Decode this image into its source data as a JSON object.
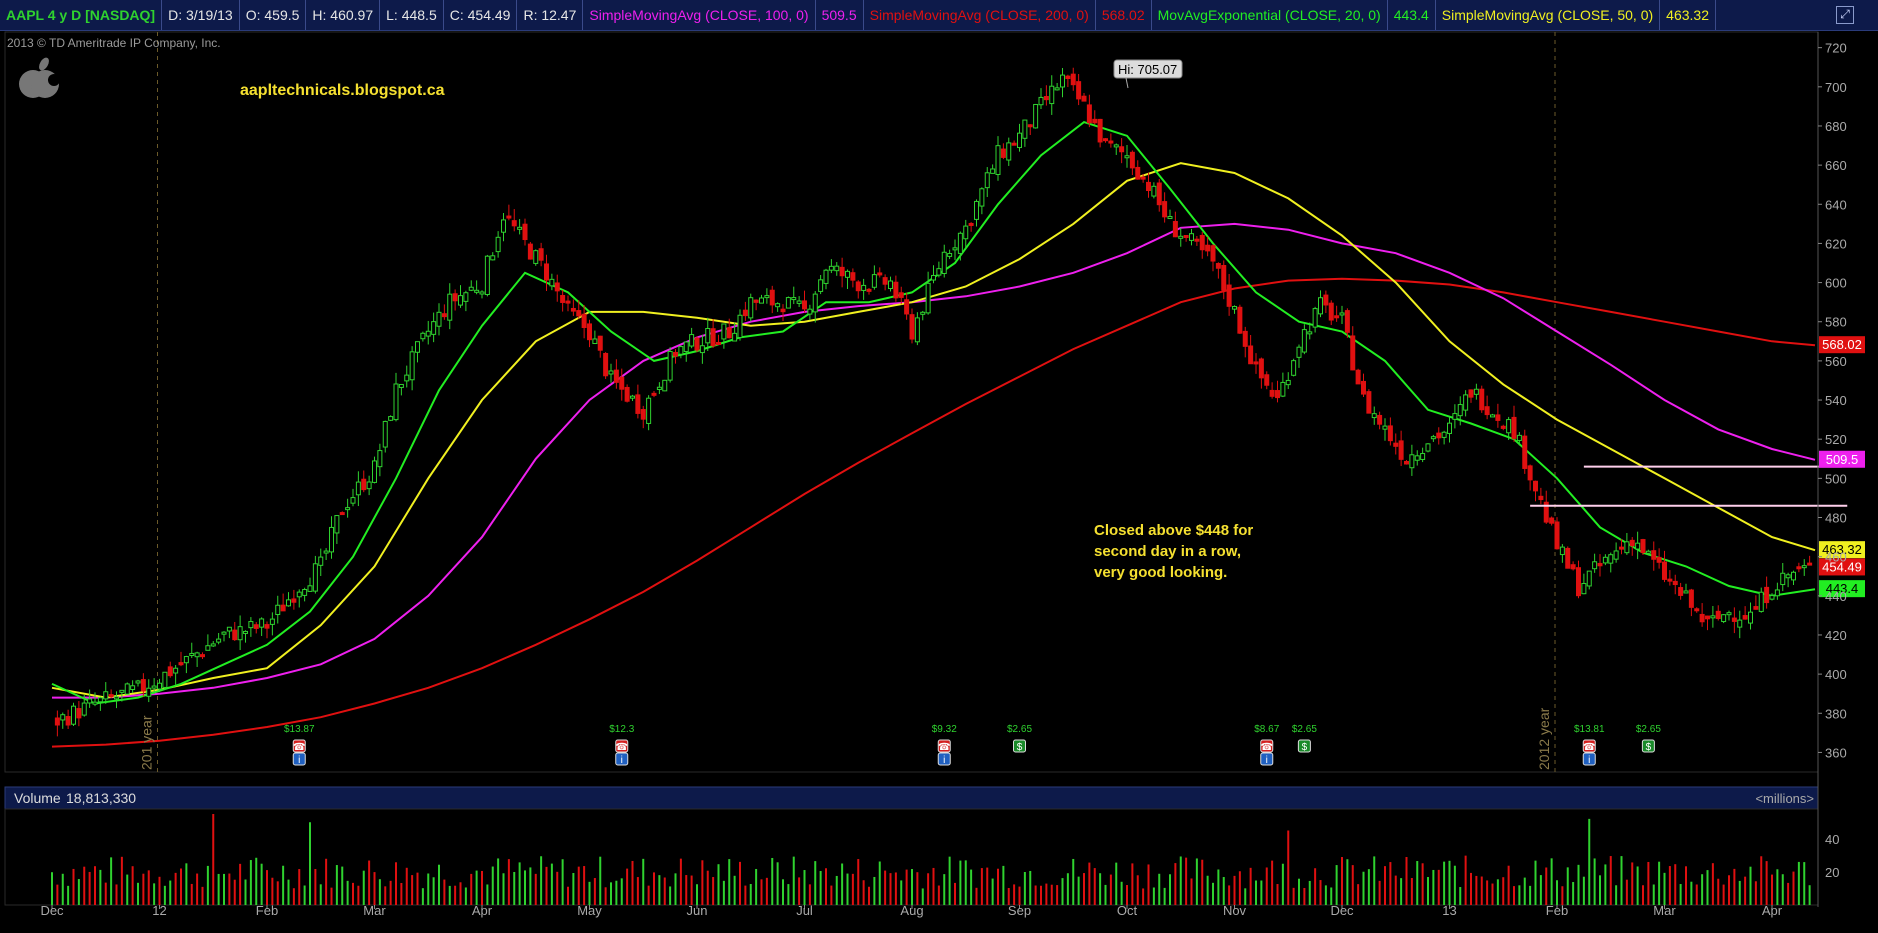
{
  "header": {
    "symbol": "AAPL 4 y D [NASDAQ]",
    "date": "D: 3/19/13",
    "open": "O: 459.5",
    "high": "H: 460.97",
    "low": "L: 448.5",
    "close": "C: 454.49",
    "range": "R: 12.47",
    "sma100_label": "SimpleMovingAvg (CLOSE, 100, 0)",
    "sma100_value": "509.5",
    "sma200_label": "SimpleMovingAvg (CLOSE, 200, 0)",
    "sma200_value": "568.02",
    "ema20_label": "MovAvgExponential (CLOSE, 20, 0)",
    "ema20_value": "443.4",
    "sma50_label": "SimpleMovingAvg (CLOSE, 50, 0)",
    "sma50_value": "463.32",
    "expand_icon": "expand-icon",
    "expand_glyph": "⤢"
  },
  "copyright": "2013 © TD Ameritrade IP Company, Inc.",
  "watermark": "aapltechnicals.blogspot.ca",
  "logo_icon": "apple-logo-icon",
  "annotation": [
    "Closed above $448 for",
    "second day in a row,",
    "very good looking."
  ],
  "high_marker": "Hi: 705.07",
  "year_markers": [
    "201 year",
    "2012 year"
  ],
  "volume_panel": {
    "label": "Volume",
    "value": "18,813,330",
    "units": "<millions>"
  },
  "colors": {
    "up": "#2fd22f",
    "down": "#e01010",
    "ema20": "#22ee22",
    "sma50": "#f0f020",
    "sma100": "#ee20ee",
    "sma200": "#e01010",
    "resistance": "#ffd0ec",
    "header_bg": "#0d1a4a",
    "symbol": "#2fd22f",
    "annotation": "#f5e030"
  },
  "events": [
    {
      "label": "$13.87",
      "month_index": 2.3,
      "icons": [
        "earnings-icon",
        "info-icon"
      ]
    },
    {
      "label": "$12.3",
      "month_index": 5.3,
      "icons": [
        "earnings-icon",
        "info-icon"
      ]
    },
    {
      "label": "$9.32",
      "month_index": 8.3,
      "icons": [
        "earnings-icon",
        "info-icon"
      ]
    },
    {
      "label": "$2.65",
      "month_index": 9.0,
      "icons": [
        "dividend-icon"
      ]
    },
    {
      "label": "$8.67",
      "month_index": 11.3,
      "icons": [
        "earnings-icon",
        "info-icon"
      ]
    },
    {
      "label": "$2.65",
      "month_index": 11.65,
      "icons": [
        "dividend-icon"
      ]
    },
    {
      "label": "$13.81",
      "month_index": 14.3,
      "icons": [
        "earnings-icon",
        "info-icon"
      ]
    },
    {
      "label": "$2.65",
      "month_index": 14.85,
      "icons": [
        "dividend-icon"
      ]
    }
  ],
  "chart_data": {
    "type": "line",
    "title": "AAPL 4 y D [NASDAQ]",
    "x_labels": [
      "Dec",
      "12",
      "Feb",
      "Mar",
      "Apr",
      "May",
      "Jun",
      "Jul",
      "Aug",
      "Sep",
      "Oct",
      "Nov",
      "Dec",
      "13",
      "Feb",
      "Mar",
      "Apr"
    ],
    "y_ticks": [
      360,
      380,
      400,
      420,
      440,
      460,
      480,
      500,
      520,
      540,
      560,
      580,
      600,
      620,
      640,
      660,
      680,
      700,
      720
    ],
    "ylim": [
      350,
      728
    ],
    "series": [
      {
        "name": "price",
        "x": [
          0,
          0.4,
          0.8,
          1.0,
          1.2,
          1.6,
          2.0,
          2.3,
          2.5,
          2.7,
          3.0,
          3.2,
          3.5,
          3.7,
          4.0,
          4.2,
          4.4,
          4.6,
          4.8,
          5.0,
          5.2,
          5.5,
          5.8,
          6.0,
          6.3,
          6.5,
          6.8,
          7.0,
          7.2,
          7.5,
          7.8,
          8.0,
          8.3,
          8.5,
          8.8,
          9.0,
          9.2,
          9.4,
          9.6,
          9.8,
          10.0,
          10.2,
          10.4,
          10.6,
          10.8,
          11.0,
          11.2,
          11.4,
          11.6,
          11.8,
          12.0,
          12.2,
          12.4,
          12.6,
          12.8,
          13.0,
          13.2,
          13.4,
          13.6,
          13.8,
          14.0,
          14.2,
          14.5,
          14.7,
          15.0,
          15.2,
          15.4,
          15.6,
          15.8,
          16.0,
          16.2,
          16.4
        ],
        "values": [
          375,
          385,
          392,
          398,
          405,
          420,
          425,
          445,
          455,
          485,
          505,
          545,
          575,
          590,
          600,
          635,
          620,
          605,
          585,
          575,
          550,
          535,
          565,
          570,
          575,
          590,
          590,
          585,
          608,
          600,
          600,
          575,
          615,
          628,
          665,
          675,
          690,
          704,
          690,
          670,
          665,
          650,
          630,
          620,
          610,
          585,
          555,
          540,
          570,
          588,
          580,
          540,
          525,
          510,
          520,
          525,
          545,
          535,
          525,
          495,
          465,
          445,
          460,
          470,
          450,
          438,
          425,
          432,
          430,
          445,
          452,
          454.49
        ]
      },
      {
        "name": "MovAvgExponential (CLOSE, 20, 0)",
        "x": [
          0,
          0.4,
          0.8,
          1.2,
          1.6,
          2.0,
          2.4,
          2.8,
          3.2,
          3.6,
          4.0,
          4.4,
          4.8,
          5.2,
          5.6,
          6.0,
          6.4,
          6.8,
          7.2,
          7.6,
          8.0,
          8.4,
          8.8,
          9.2,
          9.6,
          10.0,
          10.4,
          10.8,
          11.2,
          11.6,
          12.0,
          12.4,
          12.8,
          13.2,
          13.6,
          14.0,
          14.4,
          14.8,
          15.2,
          15.6,
          16.0,
          16.4
        ],
        "values": [
          395,
          385,
          388,
          395,
          405,
          415,
          432,
          460,
          500,
          545,
          578,
          605,
          595,
          575,
          560,
          565,
          572,
          575,
          590,
          590,
          595,
          610,
          640,
          665,
          682,
          675,
          648,
          620,
          595,
          580,
          575,
          560,
          535,
          528,
          520,
          500,
          475,
          462,
          455,
          445,
          440,
          443.4
        ]
      },
      {
        "name": "SimpleMovingAvg (CLOSE, 50, 0)",
        "x": [
          0,
          0.5,
          1.0,
          1.5,
          2.0,
          2.5,
          3.0,
          3.5,
          4.0,
          4.5,
          5.0,
          5.5,
          6.0,
          6.5,
          7.0,
          7.5,
          8.0,
          8.5,
          9.0,
          9.5,
          10.0,
          10.5,
          11.0,
          11.5,
          12.0,
          12.5,
          13.0,
          13.5,
          14.0,
          14.5,
          15.0,
          15.5,
          16.0,
          16.4
        ],
        "values": [
          393,
          388,
          392,
          398,
          403,
          425,
          455,
          500,
          540,
          570,
          585,
          585,
          582,
          578,
          580,
          585,
          590,
          598,
          612,
          630,
          652,
          661,
          656,
          643,
          624,
          600,
          570,
          548,
          530,
          515,
          500,
          485,
          470,
          463.32
        ]
      },
      {
        "name": "SimpleMovingAvg (CLOSE, 100, 0)",
        "x": [
          0,
          0.5,
          1.0,
          1.5,
          2.0,
          2.5,
          3.0,
          3.5,
          4.0,
          4.5,
          5.0,
          5.5,
          6.0,
          6.5,
          7.0,
          7.5,
          8.0,
          8.5,
          9.0,
          9.5,
          10.0,
          10.5,
          11.0,
          11.5,
          12.0,
          12.5,
          13.0,
          13.5,
          14.0,
          14.5,
          15.0,
          15.5,
          16.0,
          16.4
        ],
        "values": [
          388,
          388,
          390,
          393,
          398,
          405,
          418,
          440,
          470,
          510,
          540,
          560,
          572,
          580,
          585,
          588,
          590,
          593,
          598,
          605,
          615,
          628,
          630,
          627,
          620,
          615,
          605,
          592,
          575,
          558,
          540,
          525,
          515,
          509.5
        ]
      },
      {
        "name": "SimpleMovingAvg (CLOSE, 200, 0)",
        "x": [
          0,
          0.5,
          1.0,
          1.5,
          2.0,
          2.5,
          3.0,
          3.5,
          4.0,
          4.5,
          5.0,
          5.5,
          6.0,
          6.5,
          7.0,
          7.5,
          8.0,
          8.5,
          9.0,
          9.5,
          10.0,
          10.5,
          11.0,
          11.5,
          12.0,
          12.5,
          13.0,
          13.5,
          14.0,
          14.5,
          15.0,
          15.5,
          16.0,
          16.4
        ],
        "values": [
          363,
          364,
          366,
          369,
          373,
          378,
          385,
          393,
          403,
          415,
          428,
          442,
          458,
          475,
          492,
          508,
          523,
          538,
          552,
          566,
          578,
          590,
          597,
          601,
          602,
          601,
          599,
          595,
          590,
          585,
          580,
          575,
          570,
          568.02
        ]
      }
    ],
    "resistance_levels": [
      {
        "value": 506,
        "x_start": 14.25,
        "x_end": 16.65
      },
      {
        "value": 486,
        "x_start": 13.75,
        "x_end": 16.7
      }
    ],
    "price_labels": [
      {
        "value": 568.02,
        "text": "568.02",
        "color": "#e01010"
      },
      {
        "value": 509.5,
        "text": "509.5",
        "color": "#ee20ee"
      },
      {
        "value": 463.32,
        "text": "463.32",
        "color": "#f0f020"
      },
      {
        "value": 454.49,
        "text": "454.49",
        "color": "#e01010"
      },
      {
        "value": 443.4,
        "text": "443.4",
        "color": "#22ee22"
      }
    ],
    "volume": {
      "y_ticks": [
        20,
        40
      ],
      "ylim": [
        0,
        58
      ],
      "spikes": [
        {
          "x": 1.5,
          "value": 55
        },
        {
          "x": 2.4,
          "value": 50
        },
        {
          "x": 11.5,
          "value": 45
        },
        {
          "x": 14.3,
          "value": 52
        }
      ],
      "typical_range": [
        10,
        30
      ]
    }
  }
}
